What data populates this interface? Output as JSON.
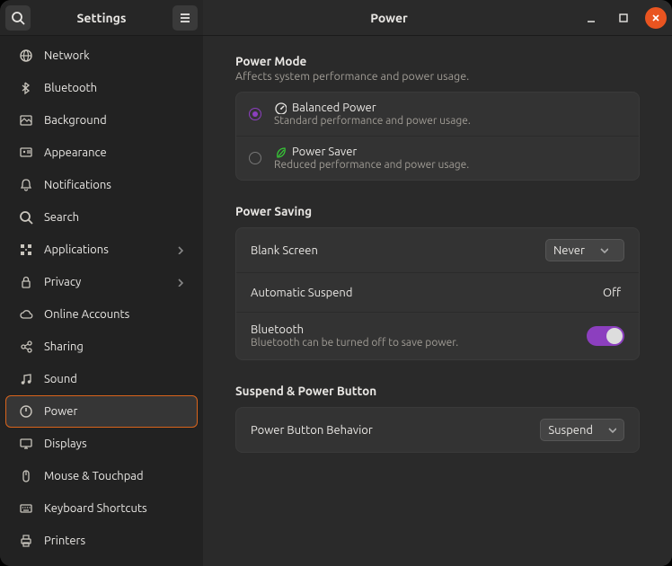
{
  "header": {
    "sidebar_title": "Settings",
    "main_title": "Power"
  },
  "sidebar": {
    "items": [
      {
        "icon": "globe",
        "label": "Network"
      },
      {
        "icon": "bluetooth",
        "label": "Bluetooth"
      },
      {
        "icon": "background",
        "label": "Background"
      },
      {
        "icon": "appearance",
        "label": "Appearance"
      },
      {
        "icon": "bell",
        "label": "Notifications"
      },
      {
        "icon": "search",
        "label": "Search"
      },
      {
        "icon": "grid",
        "label": "Applications",
        "chevron": true
      },
      {
        "icon": "lock",
        "label": "Privacy",
        "chevron": true
      },
      {
        "icon": "cloud",
        "label": "Online Accounts"
      },
      {
        "icon": "share",
        "label": "Sharing"
      },
      {
        "icon": "music",
        "label": "Sound"
      },
      {
        "icon": "power",
        "label": "Power",
        "selected": true
      },
      {
        "icon": "display",
        "label": "Displays"
      },
      {
        "icon": "mouse",
        "label": "Mouse & Touchpad"
      },
      {
        "icon": "keyboard",
        "label": "Keyboard Shortcuts"
      },
      {
        "icon": "printer",
        "label": "Printers"
      }
    ]
  },
  "power_mode": {
    "title": "Power Mode",
    "desc": "Affects system performance and power usage.",
    "options": [
      {
        "title": "Balanced Power",
        "sub": "Standard performance and power usage.",
        "icon": "gauge",
        "checked": true
      },
      {
        "title": "Power Saver",
        "sub": "Reduced performance and power usage.",
        "icon": "leaf",
        "checked": false,
        "green": true
      }
    ]
  },
  "power_saving": {
    "title": "Power Saving",
    "blank_screen": {
      "label": "Blank Screen",
      "value": "Never"
    },
    "auto_suspend": {
      "label": "Automatic Suspend",
      "value": "Off"
    },
    "bluetooth": {
      "label": "Bluetooth",
      "sub": "Bluetooth can be turned off to save power.",
      "on": true
    }
  },
  "suspend_btn": {
    "title": "Suspend & Power Button",
    "power_button": {
      "label": "Power Button Behavior",
      "value": "Suspend"
    }
  }
}
